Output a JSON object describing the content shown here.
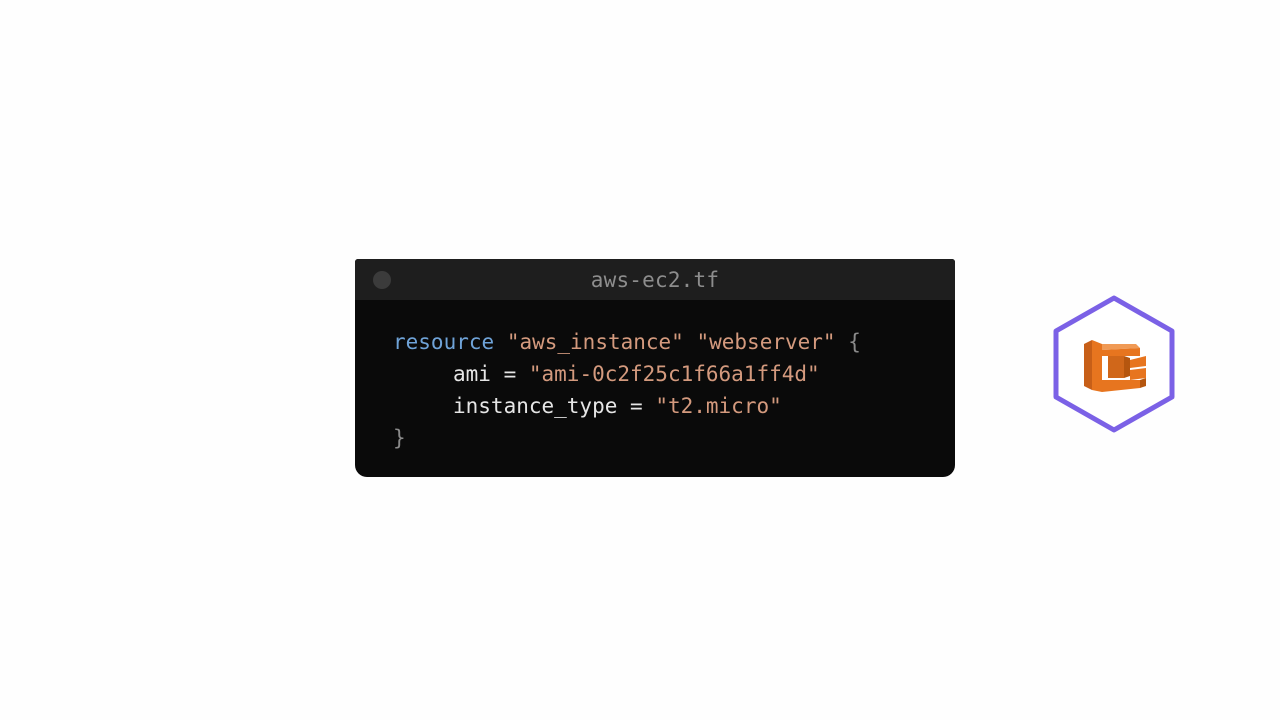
{
  "editor": {
    "filename": "aws-ec2.tf",
    "code": {
      "line1": {
        "keyword": "resource",
        "type": "\"aws_instance\"",
        "name": "\"webserver\"",
        "open": "{"
      },
      "line2": {
        "key": "ami",
        "eq": " = ",
        "value": "\"ami-0c2f25c1f66a1ff4d\""
      },
      "line3": {
        "key": "instance_type",
        "eq": " = ",
        "value": "\"t2.micro\""
      },
      "line4": {
        "close": "}"
      }
    }
  },
  "logo": {
    "icon": "aws-ecs-icon",
    "ring_color": "#7b61e6",
    "brand_color": "#e7751f"
  },
  "colors": {
    "keyword": "#6fa3d8",
    "string": "#d49a7e",
    "editor_bg": "#0a0a0a",
    "titlebar_bg": "#1e1e1e"
  }
}
